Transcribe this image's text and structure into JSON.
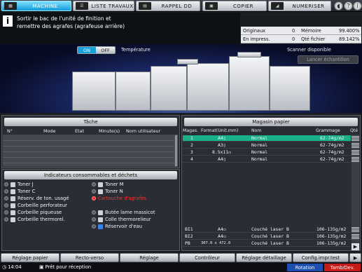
{
  "tabs": [
    {
      "label": "MACHINE",
      "icon": "machine-icon"
    },
    {
      "label": "LISTE TRAVAUX",
      "icon": "job-list-icon"
    },
    {
      "label": "RAPPEL DD",
      "icon": "hdd-recall-icon"
    },
    {
      "label": "COPIER",
      "icon": "copier-icon"
    },
    {
      "label": "NUMERISER",
      "icon": "scanner-icon"
    }
  ],
  "header_icons": [
    "sound-icon",
    "help-icon",
    "info-icon"
  ],
  "message": {
    "line1": "Sortir le bac de l'unité de finition et",
    "line2": "remettre des agrafes (agrafeuse arrière)"
  },
  "counters": {
    "originaux_label": "Originaux",
    "originaux_value": "0",
    "memoire_label": "Mémoire",
    "memoire_value": "99.400%",
    "impress_label": "En impress.",
    "impress_value": "0",
    "qte_label": "Qté fichier",
    "qte_value": "89.142%"
  },
  "temperature": {
    "on": "ON",
    "off": "OFF",
    "label": "Température"
  },
  "scanner": {
    "status": "Scanner disponible",
    "sample_button": "Lancer échantillon"
  },
  "tache": {
    "title": "Tâche",
    "columns": [
      "N°",
      "Mode",
      "Etat",
      "Minute(s)",
      "Nom utilisateur"
    ]
  },
  "magasin": {
    "title": "Magasin papier",
    "columns": [
      "Magas.",
      "Format(Unit.mm)",
      "Nom",
      "Grammage",
      "Qté"
    ],
    "rows": [
      {
        "tray": "1",
        "format": "A4▯",
        "name": "Normal",
        "weight": "62-74g/m2",
        "selected": true
      },
      {
        "tray": "2",
        "format": "A3▯",
        "name": "Normal",
        "weight": "62-74g/m2"
      },
      {
        "tray": "3",
        "format": "8.5x11▭",
        "name": "Normal",
        "weight": "62-74g/m2"
      },
      {
        "tray": "4",
        "format": "A4▯",
        "name": "Normal",
        "weight": "62-74g/m2"
      }
    ],
    "rows2": [
      {
        "tray": "BI1",
        "format": "A4▭",
        "name": "Couché laser B",
        "weight": "106-135g/m2"
      },
      {
        "tray": "BI2",
        "format": "A4▭",
        "name": "Couché laser B",
        "weight": "106-135g/m2"
      },
      {
        "tray": "PB",
        "format": "307.0 x 472.0",
        "name": "Couché laser B",
        "weight": "106-135g/m2"
      }
    ]
  },
  "indicateurs": {
    "title": "Indicateurs consommables et déchets",
    "left": [
      "Toner J",
      "Toner C",
      "Réserv. de ton. usagé",
      "Corbeille perforateur",
      "Corbeille piqueuse",
      "Corbeille thermorel."
    ],
    "right": [
      "Toner M",
      "Toner N",
      "Cartouche d'agrafes",
      "Butée lame massicot",
      "Colle thermorelieur",
      "Réservoir d'eau"
    ]
  },
  "bottom_buttons": [
    "Réglage papier",
    "Recto-verso",
    "Réglage",
    "Contrôleur",
    "Réglage détaillage",
    "Config.impr.test"
  ],
  "status": {
    "time": "14:04",
    "text": "Prêt pour réception",
    "rotation": "Rotation",
    "tamb": "Tamb/Dev."
  },
  "colors": {
    "accent": "#129ad6",
    "selected_row": "#1ab08a",
    "alert": "#ff2a2a",
    "rotation": "#1b4fb0",
    "tamb": "#c31a1a"
  }
}
